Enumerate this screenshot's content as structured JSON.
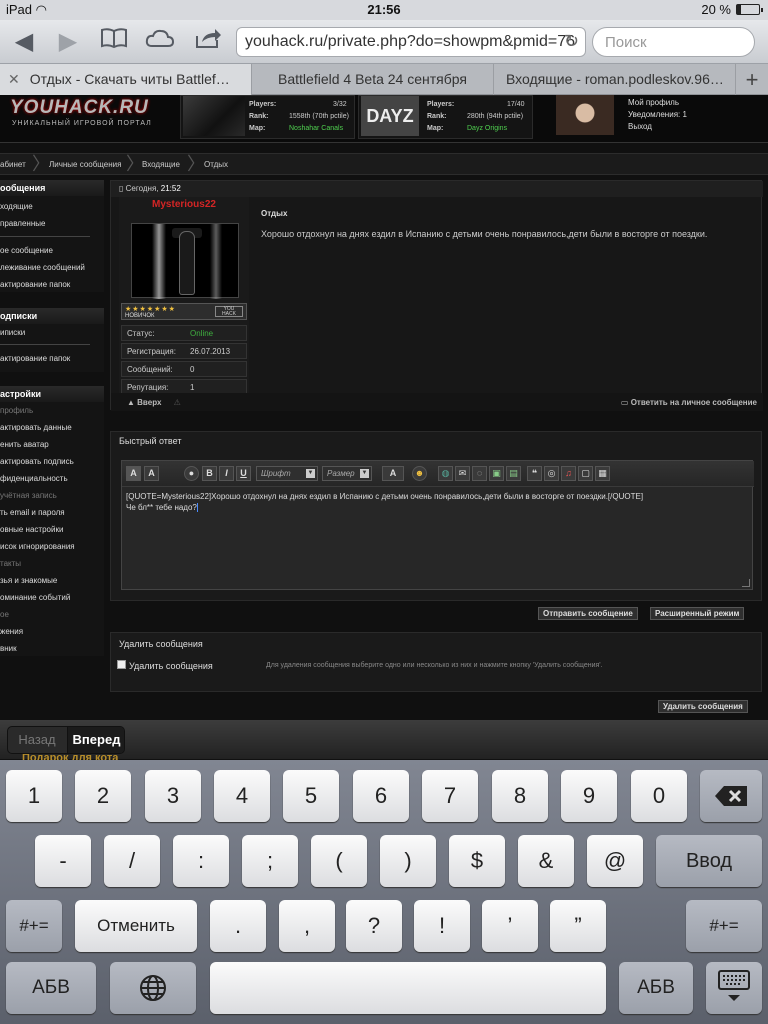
{
  "status_bar": {
    "device": "iPad",
    "time": "21:56",
    "battery": "20 %",
    "battery_level": 0.2
  },
  "toolbar": {
    "url": "youhack.ru/private.php?do=showpm&pmid=76",
    "search_placeholder": "Поиск"
  },
  "tabs": [
    {
      "label": "Отдых - Скачать читы Battlef…"
    },
    {
      "label": "Battlefield 4 Beta 24 сентября"
    },
    {
      "label": "Входящие - roman.podleskov.96…"
    }
  ],
  "site": {
    "logo": "YOUHACK.RU",
    "logo_sub": "УНИКАЛЬНЫЙ ИГРОВОЙ ПОРТАЛ",
    "servers": [
      {
        "players_label": "Players:",
        "players": "3/32",
        "rank_label": "Rank:",
        "rank": "1558th (70th pctile)",
        "map_label": "Map:",
        "map": "Noshahar Canals"
      },
      {
        "logo": "DAYZ",
        "players_label": "Players:",
        "players": "17/40",
        "rank_label": "Rank:",
        "rank": "280th (94th pctile)",
        "map_label": "Map:",
        "map": "Dayz Origins"
      }
    ],
    "profile_links": [
      "Мой профиль",
      "Уведомления: 1",
      "Выход"
    ]
  },
  "breadcrumb": [
    "абинет",
    "Личные сообщения",
    "Входящие",
    "Отдых"
  ],
  "leftnav": {
    "messages": {
      "title": "ообщения",
      "items": [
        "ходящие",
        "правленные",
        "ое сообщение",
        "леживание сообщений",
        "актирование папок"
      ]
    },
    "subs": {
      "title": "одписки",
      "items": [
        "иписки",
        "актирование папок"
      ]
    },
    "settings": {
      "title": "астройки",
      "items": [
        "профиль",
        "актировать данные",
        "енить аватар",
        "актировать подпись",
        "фиденциальность",
        "учётная запись",
        "ть email и пароля",
        "овные настройки",
        "исок игнорирования",
        "такты",
        "зья и знакомые",
        "оминание событий",
        "ое",
        "жения",
        "вник"
      ]
    }
  },
  "post": {
    "date_label": "Сегодня,",
    "time": "21:52",
    "username": "Mysterious22",
    "rank_text": "НОВИЧОК",
    "rank_badge": "YOU HACK",
    "rows": [
      {
        "k": "Статус:",
        "v": "Online"
      },
      {
        "k": "Регистрация:",
        "v": "26.07.2013"
      },
      {
        "k": "Сообщений:",
        "v": "0"
      },
      {
        "k": "Репутация:",
        "v": "1"
      }
    ],
    "title": "Отдых",
    "body": "Хорошо отдохнул на днях ездил в Испанию с детьми очень понравилось,дети были в восторге от поездки.",
    "up_label": "Вверх",
    "reply_label": "Ответить на личное сообщение"
  },
  "quick_reply": {
    "title": "Быстрый ответ",
    "font_placeholder": "Шрифт",
    "size_placeholder": "Размер",
    "text_line1": "[QUOTE=Mysterious22]Хорошо отдохнул на днях ездил в Испанию с детьми очень понравилось,дети были в восторге от поездки.[/QUOTE]",
    "text_line2": "Че бл** тебе надо?",
    "send_label": "Отправить сообщение",
    "advanced_label": "Расширенный режим"
  },
  "delete_section": {
    "title": "Удалить сообщения",
    "checkbox_label": "Удалить сообщения",
    "help": "Для удаления сообщения выберите одно или несколько из них и нажмите кнопку 'Удалить сообщения'.",
    "button_label": "Удалить сообщения"
  },
  "form_assistant": {
    "back": "Назад",
    "forward": "Вперед",
    "peek": "Подарок для кота"
  },
  "keyboard": {
    "row1": [
      "1",
      "2",
      "3",
      "4",
      "5",
      "6",
      "7",
      "8",
      "9",
      "0"
    ],
    "row2": [
      "-",
      "/",
      ":",
      ";",
      "(",
      ")",
      "$",
      "&",
      "@"
    ],
    "enter": "Ввод",
    "row3_left": "#+=",
    "undo": "Отменить",
    "row3": [
      ".",
      ",",
      "?",
      "!",
      "’",
      "”"
    ],
    "row3_right": "#+=",
    "abc": "АБВ"
  }
}
